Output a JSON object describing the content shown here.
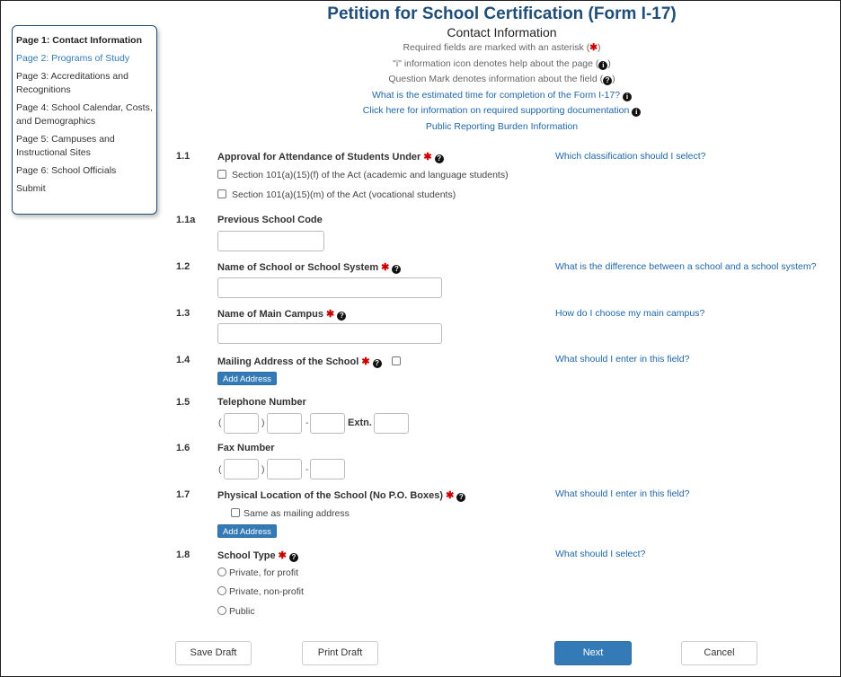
{
  "sidebar": {
    "items": [
      {
        "label": "Page 1: Contact Information",
        "state": "active"
      },
      {
        "label": "Page 2: Programs of Study",
        "state": "link"
      },
      {
        "label": "Page 3: Accreditations and Recognitions",
        "state": "normal"
      },
      {
        "label": "Page 4: School Calendar, Costs, and Demographics",
        "state": "normal"
      },
      {
        "label": "Page 5: Campuses and Instructional Sites",
        "state": "normal"
      },
      {
        "label": "Page 6: School Officials",
        "state": "normal"
      },
      {
        "label": "Submit",
        "state": "normal"
      }
    ]
  },
  "header": {
    "title": "Petition for School Certification (Form I-17)",
    "subtitle": "Contact Information",
    "note_required_prefix": "Required fields are marked with an asterisk (",
    "note_required_suffix": ")",
    "note_info_prefix": "\"i\" information icon denotes help about the page (",
    "note_info_suffix": ")",
    "note_question_prefix": "Question Mark denotes information about the field (",
    "note_question_suffix": ")",
    "link_time": "What is the estimated time for completion of the Form I-17?",
    "link_docs": "Click here for information on required supporting documentation",
    "link_burden": "Public Reporting Burden Information"
  },
  "icons": {
    "star": "✱",
    "info": "i",
    "question": "?"
  },
  "form": {
    "f1_1": {
      "num": "1.1",
      "label": "Approval for Attendance of Students Under",
      "help": "Which classification should I select?",
      "options": [
        "Section 101(a)(15)(f) of the Act (academic and language students)",
        "Section 101(a)(15)(m) of the Act (vocational students)"
      ]
    },
    "f1_1a": {
      "num": "1.1a",
      "label": "Previous School Code",
      "value": ""
    },
    "f1_2": {
      "num": "1.2",
      "label": "Name of School or School System",
      "help": "What is the difference between a school and a school system?",
      "value": ""
    },
    "f1_3": {
      "num": "1.3",
      "label": "Name of Main Campus",
      "help": "How do I choose my main campus?",
      "value": ""
    },
    "f1_4": {
      "num": "1.4",
      "label": "Mailing Address of the School",
      "help": "What should I enter in this field?",
      "button": "Add Address"
    },
    "f1_5": {
      "num": "1.5",
      "label": "Telephone Number",
      "open_paren": "(",
      "close_paren": ")",
      "dash": "-",
      "ext_label": "Extn."
    },
    "f1_6": {
      "num": "1.6",
      "label": "Fax Number",
      "open_paren": "(",
      "close_paren": ")",
      "dash": "-"
    },
    "f1_7": {
      "num": "1.7",
      "label": "Physical Location of the School (No P.O. Boxes)",
      "help": "What should I enter in this field?",
      "same_as": "Same as mailing address",
      "button": "Add Address"
    },
    "f1_8": {
      "num": "1.8",
      "label": "School Type",
      "help": "What should I select?",
      "options": [
        "Private, for profit",
        "Private, non-profit",
        "Public"
      ]
    }
  },
  "footer": {
    "save": "Save Draft",
    "print": "Print Draft",
    "next": "Next",
    "cancel": "Cancel"
  }
}
